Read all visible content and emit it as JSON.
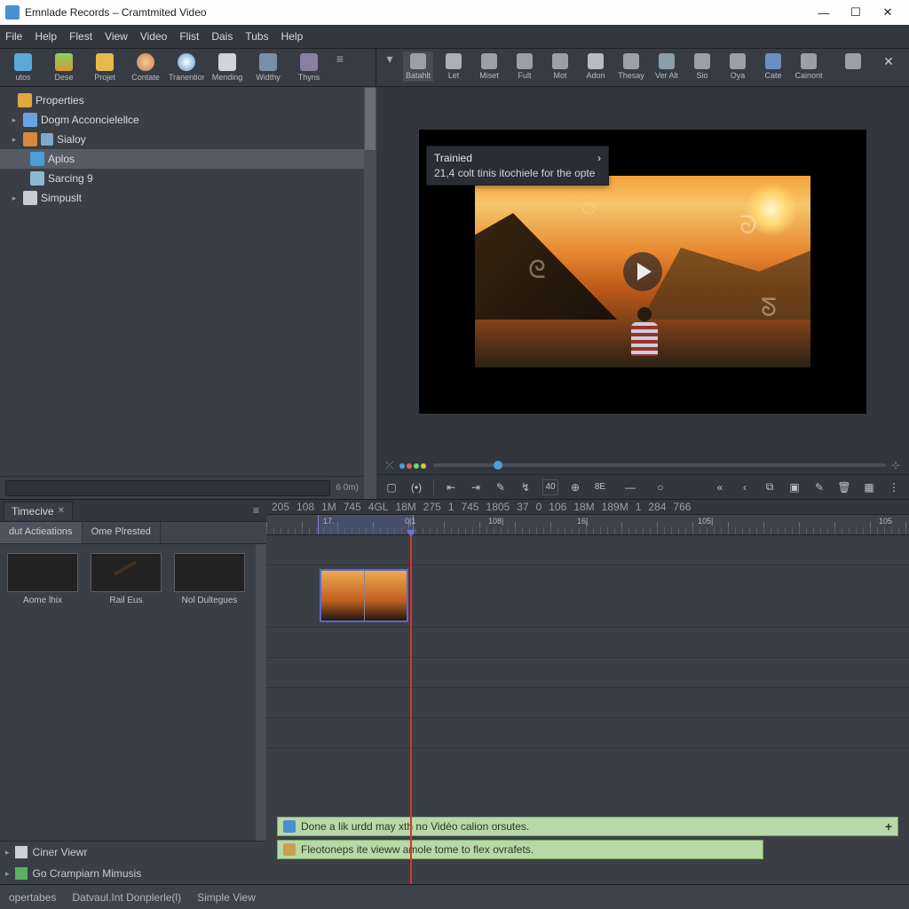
{
  "title": "Emnlade Records – Cramtmited Video",
  "menu": [
    "File",
    "Help",
    "Flest",
    "View",
    "Video",
    "Flist",
    "Dais",
    "Tubs",
    "Help"
  ],
  "toolbar_left": [
    {
      "label": "utos",
      "color": "#5aa8d8"
    },
    {
      "label": "Dese",
      "color": "#d89838"
    },
    {
      "label": "Projet",
      "color": "#e8b84a"
    },
    {
      "label": "Contate",
      "color": "#d8746a"
    },
    {
      "label": "Tranention",
      "color": "#5a98d0"
    },
    {
      "label": "Mending",
      "color": "#d0d4d8"
    },
    {
      "label": "Widthy",
      "color": "#7a8fa8"
    },
    {
      "label": "Thyns",
      "color": "#8a7fa0"
    }
  ],
  "toolbar_right": [
    {
      "label": "Batahlt",
      "color": "#9aa0a8",
      "active": true
    },
    {
      "label": "Let",
      "color": "#aab0b8"
    },
    {
      "label": "Miset",
      "color": "#9aa0a8"
    },
    {
      "label": "Fult",
      "color": "#9aa0a8"
    },
    {
      "label": "Mot",
      "color": "#9aa0a8"
    },
    {
      "label": "Adon",
      "color": "#b8bcc2"
    },
    {
      "label": "Thesay",
      "color": "#9aa0a8"
    },
    {
      "label": "Ver Alt",
      "color": "#8a9fa8"
    },
    {
      "label": "Sio",
      "color": "#9aa0a8"
    },
    {
      "label": "Oya",
      "color": "#9aa0a8"
    },
    {
      "label": "Cate",
      "color": "#9aa0a8"
    },
    {
      "label": "Cainont",
      "color": "#9aa0a8"
    }
  ],
  "tree": {
    "root": "Properties",
    "items": [
      {
        "icon": "doc",
        "label": "Dogm Acconcielellce",
        "indent": 1,
        "exp": "▸"
      },
      {
        "icon": "gear",
        "label": "Sialoy",
        "indent": 1,
        "exp": "▸"
      },
      {
        "icon": "media",
        "label": "Aplos",
        "indent": 2,
        "selected": true
      },
      {
        "icon": "star",
        "label": "Sarcing 9",
        "indent": 2
      },
      {
        "icon": "doc",
        "label": "Simpuslt",
        "indent": 1,
        "exp": "▸"
      }
    ],
    "count": "6 0m)"
  },
  "tooltip": {
    "title": "Trainied",
    "sub": "21,4 colt tinis itochiele for the opte"
  },
  "transport_nums": [
    "40",
    "8E"
  ],
  "bins": {
    "tab": "Timecive",
    "filters": [
      "dut Actieations",
      "Ome Plrested"
    ],
    "items": [
      {
        "label": "Aome lhix",
        "th": "a"
      },
      {
        "label": "Rail Eus",
        "th": "b"
      },
      {
        "label": "Nol Dultegues",
        "th": "c"
      }
    ],
    "footer": [
      "Ciner Viewr",
      "Go Crampiarn Mimusis"
    ]
  },
  "timeline": {
    "tabs": [
      "205",
      "108",
      "1M",
      "745",
      "4GL",
      "18M",
      "275",
      "1",
      "745",
      "1805",
      "37",
      "0",
      "106",
      "18M",
      "189M",
      "1",
      "284",
      "766"
    ],
    "ruler": [
      "17.",
      "0|1",
      "108|",
      "16|",
      "105|",
      "105"
    ],
    "hints": [
      "Done a lik urdd may xth no Vidéo calion orsutes.",
      "Fleotoneps ite vieww amole tome to flex ovrafets."
    ]
  },
  "status": [
    "opertabes",
    "Datvaul.Int Donplerle(l)",
    "Simple View"
  ]
}
